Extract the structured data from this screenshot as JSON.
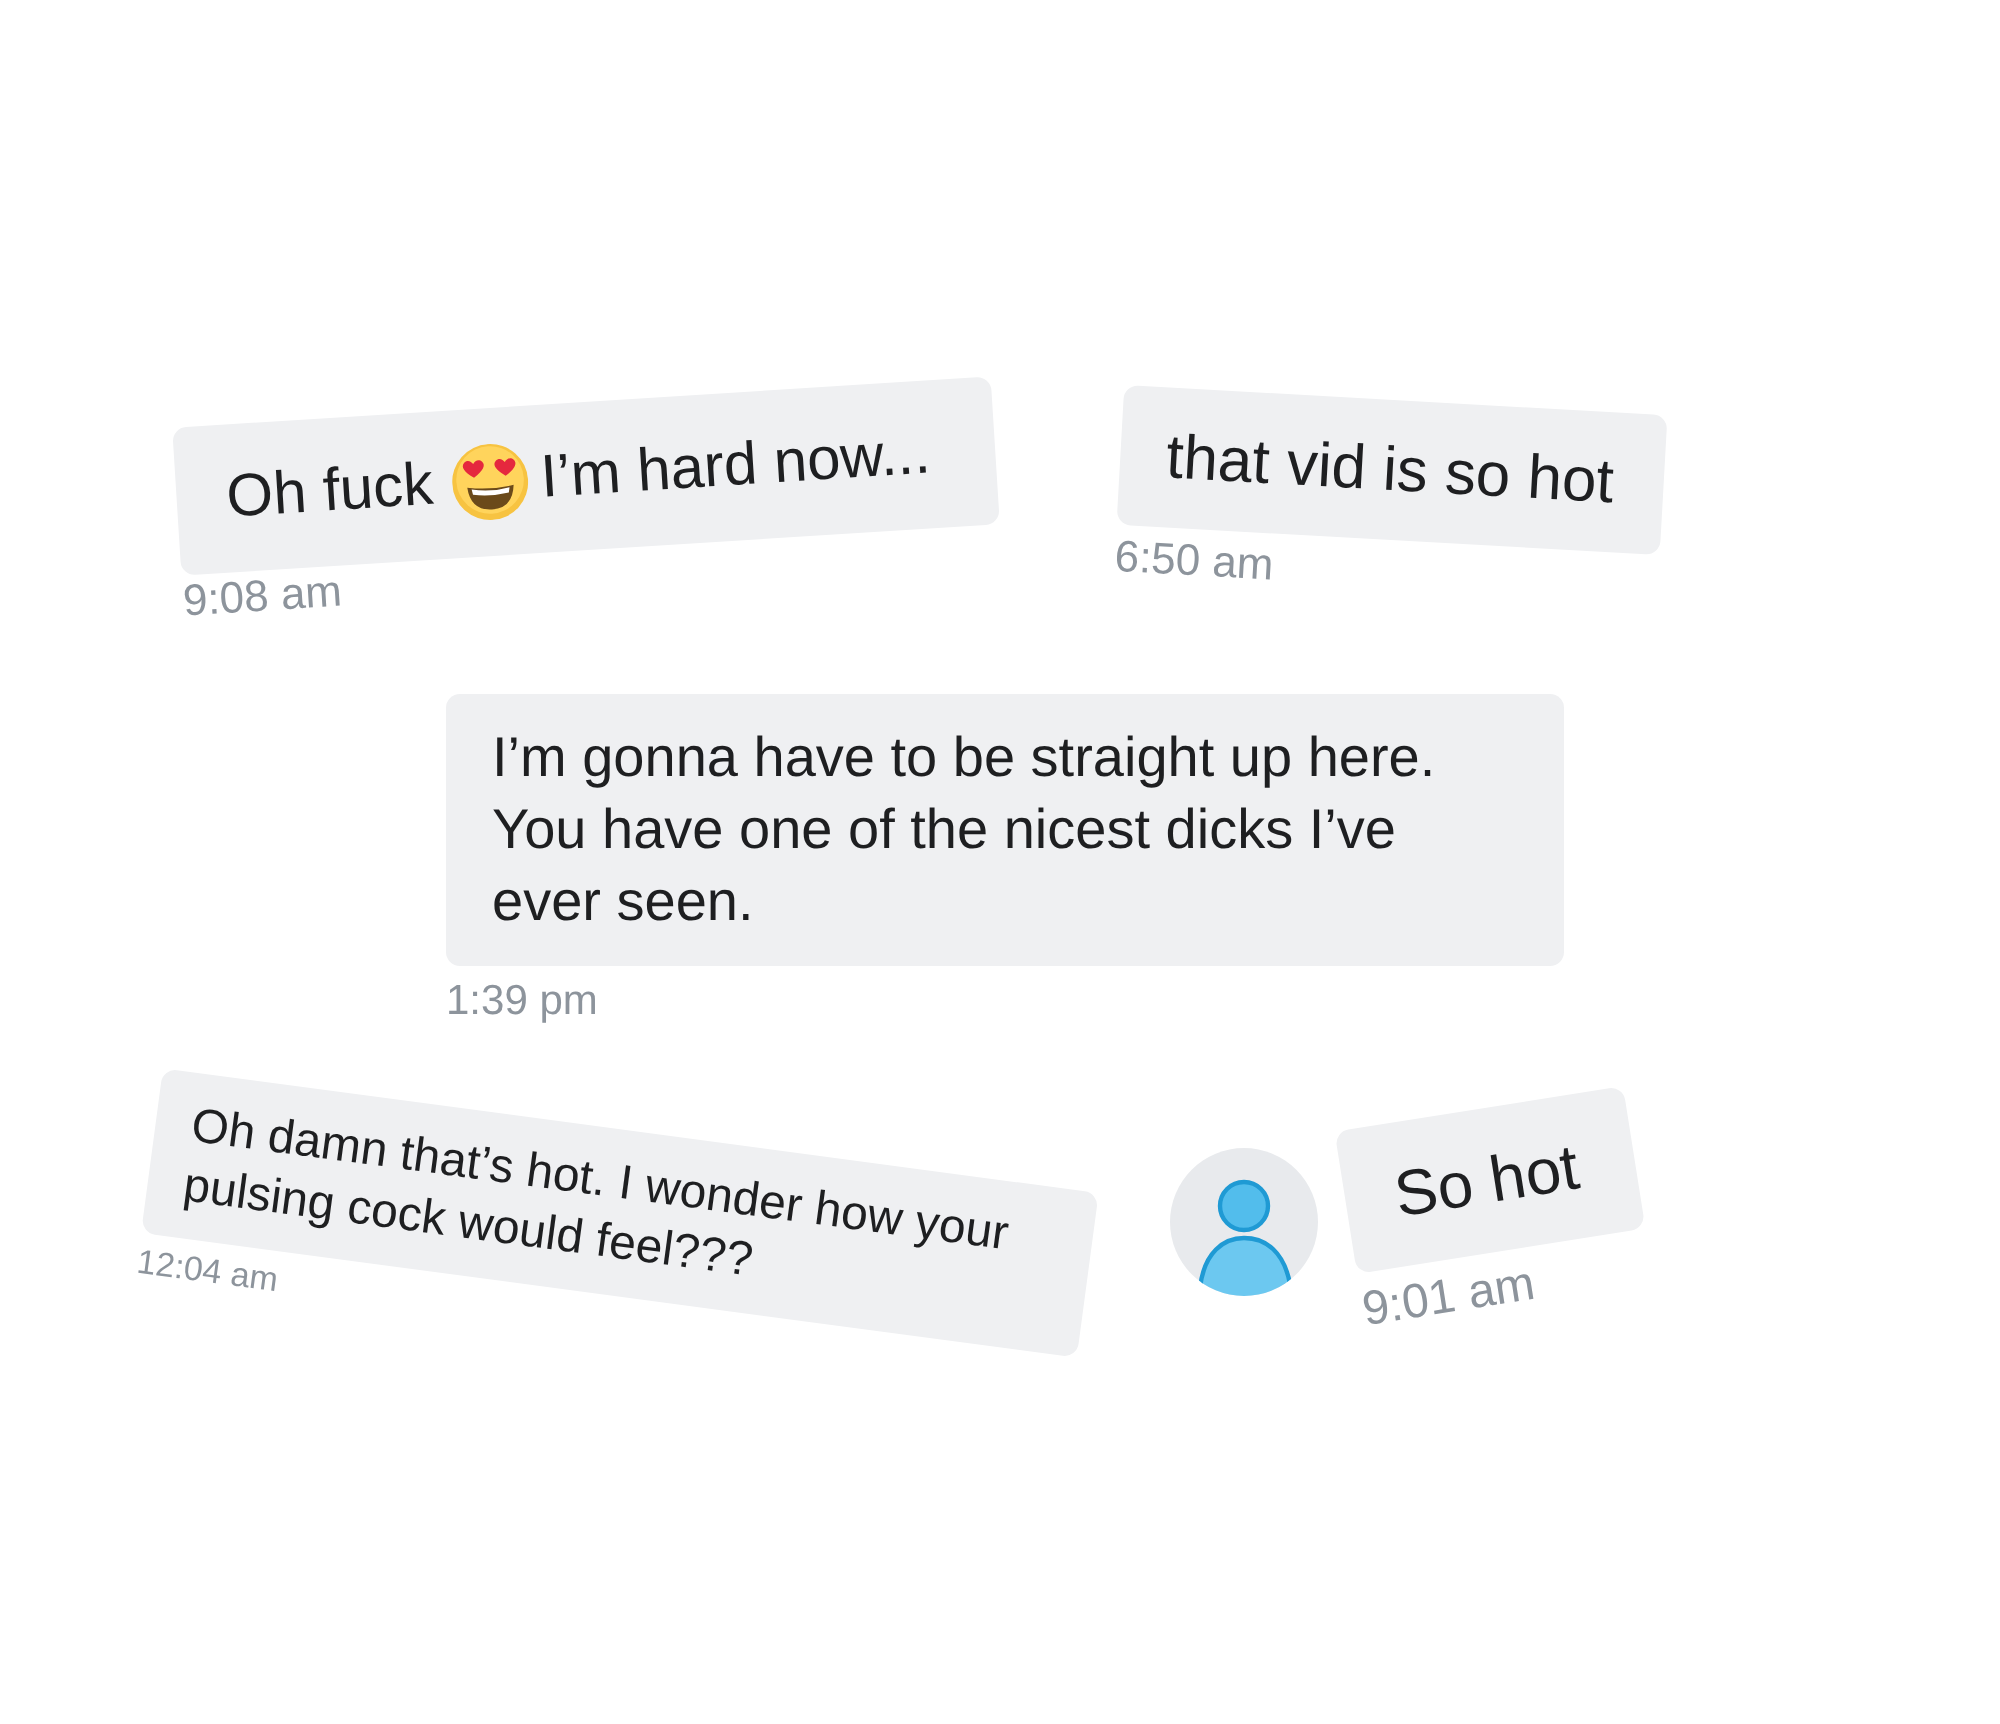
{
  "messages": [
    {
      "kind": "emoji",
      "text_before": "Oh fuck",
      "text_after": "I’m hard now...",
      "time": "9:08 am"
    },
    {
      "kind": "text",
      "text": "that vid is so hot",
      "time": "6:50 am"
    },
    {
      "kind": "text",
      "text": "I’m gonna have to be straight up here. You have one of the nicest dicks I’ve ever seen.",
      "time": "1:39 pm"
    },
    {
      "kind": "text",
      "text": "Oh damn that’s hot. I wonder how your pulsing cock would feel???",
      "time": "12:04 am"
    },
    {
      "kind": "avatar",
      "text": "So hot",
      "time": "9:01 am"
    }
  ]
}
